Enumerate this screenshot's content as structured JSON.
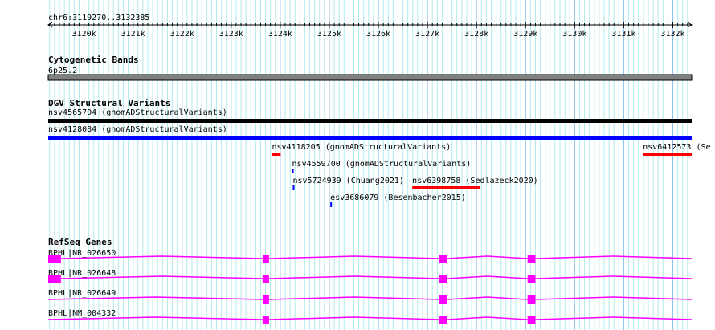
{
  "ruler": {
    "label": "chr6:3119270..3132385",
    "start": 3119270,
    "end": 3132385,
    "ticks": [
      "3120k",
      "3121k",
      "3122k",
      "3123k",
      "3124k",
      "3125k",
      "3126k",
      "3127k",
      "3128k",
      "3129k",
      "3130k",
      "3131k",
      "3132k"
    ]
  },
  "cytobands": {
    "title": "Cytogenetic Bands",
    "band": "6p25.2",
    "color": "#808080"
  },
  "dgv": {
    "title": "DGV Structural Variants",
    "features": [
      {
        "label": "nsv4565704 (gnomADStructuralVariants)",
        "start": 3119270,
        "end": 3132385,
        "color": "#000000"
      },
      {
        "label": "nsv4128084 (gnomADStructuralVariants)",
        "start": 3119270,
        "end": 3132385,
        "color": "#0000ff"
      },
      {
        "label": "nsv4118205 (gnomADStructuralVariants)",
        "start": 3123830,
        "end": 3124010,
        "color": "#ff0000"
      },
      {
        "label": "nsv6412573 (Se",
        "start": 3131390,
        "end": 3132385,
        "color": "#ff0000"
      },
      {
        "label": "nsv4559700 (gnomADStructuralVariants)",
        "start": 3124240,
        "end": 3124270,
        "color": "#0000ff"
      },
      {
        "label": "nsv5724939 (Chuang2021)",
        "start": 3124255,
        "end": 3124285,
        "color": "#0000ff"
      },
      {
        "label": "nsv6398758 (Sedlazeck2020)",
        "start": 3126690,
        "end": 3128080,
        "color": "#ff0000"
      },
      {
        "label": "esv3686079 (Besenbacher2015)",
        "start": 3125020,
        "end": 3125050,
        "color": "#0000ff"
      }
    ]
  },
  "genes": {
    "title": "RefSeq Genes",
    "color": "#ff00ff",
    "items": [
      {
        "label": "BPHL|NR_026650",
        "exons": [
          [
            3119270,
            3119530
          ],
          [
            3123640,
            3123770
          ],
          [
            3127240,
            3127400
          ],
          [
            3129040,
            3129200
          ]
        ]
      },
      {
        "label": "BPHL|NR_026648",
        "exons": [
          [
            3119270,
            3119530
          ],
          [
            3123640,
            3123770
          ],
          [
            3127240,
            3127400
          ],
          [
            3129040,
            3129200
          ]
        ]
      },
      {
        "label": "BPHL|NR_026649",
        "exons": [
          [
            3123640,
            3123770
          ],
          [
            3127240,
            3127400
          ],
          [
            3129040,
            3129200
          ]
        ]
      },
      {
        "label": "BPHL|NM_004332",
        "exons": [
          [
            3123640,
            3123770
          ],
          [
            3127240,
            3127400
          ],
          [
            3129040,
            3129200
          ]
        ]
      }
    ]
  }
}
